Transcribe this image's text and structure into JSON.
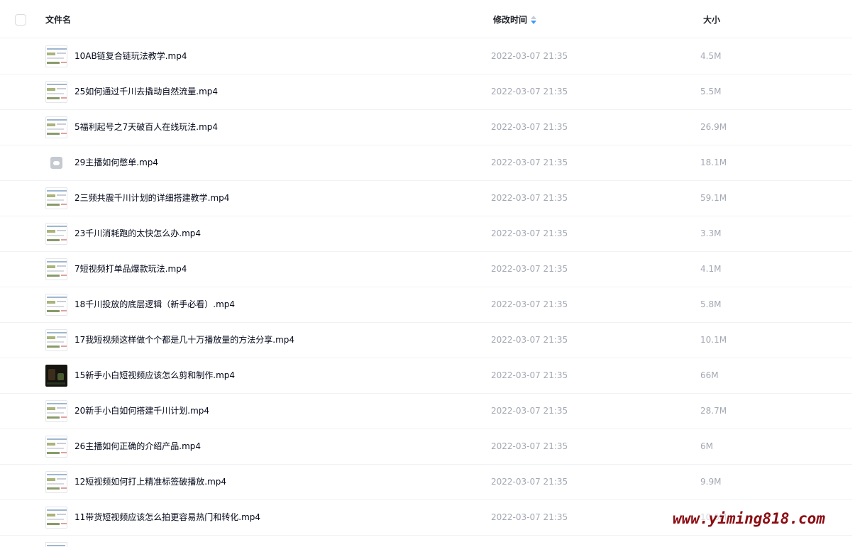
{
  "header": {
    "name_label": "文件名",
    "time_label": "修改时间",
    "size_label": "大小",
    "sort_icon": "sort-descending-icon"
  },
  "files": [
    {
      "name": "10AB链复合链玩法教学.mp4",
      "time": "2022-03-07 21:35",
      "size": "4.5M",
      "thumb": "screen"
    },
    {
      "name": "25如何通过千川去撬动自然流量.mp4",
      "time": "2022-03-07 21:35",
      "size": "5.5M",
      "thumb": "screen"
    },
    {
      "name": "5福利起号之7天破百人在线玩法.mp4",
      "time": "2022-03-07 21:35",
      "size": "26.9M",
      "thumb": "screen"
    },
    {
      "name": "29主播如何憋单.mp4",
      "time": "2022-03-07 21:35",
      "size": "18.1M",
      "thumb": "cloud"
    },
    {
      "name": "2三频共震千川计划的详细搭建教学.mp4",
      "time": "2022-03-07 21:35",
      "size": "59.1M",
      "thumb": "screen"
    },
    {
      "name": "23千川消耗跑的太快怎么办.mp4",
      "time": "2022-03-07 21:35",
      "size": "3.3M",
      "thumb": "screen"
    },
    {
      "name": "7短视频打单品爆款玩法.mp4",
      "time": "2022-03-07 21:35",
      "size": "4.1M",
      "thumb": "screen"
    },
    {
      "name": "18千川投放的底层逻辑（新手必看）.mp4",
      "time": "2022-03-07 21:35",
      "size": "5.8M",
      "thumb": "screen"
    },
    {
      "name": "17我短视频这样做个个都是几十万播放量的方法分享.mp4",
      "time": "2022-03-07 21:35",
      "size": "10.1M",
      "thumb": "screen"
    },
    {
      "name": "15新手小白短视频应该怎么剪和制作.mp4",
      "time": "2022-03-07 21:35",
      "size": "66M",
      "thumb": "dark"
    },
    {
      "name": "20新手小白如何搭建千川计划.mp4",
      "time": "2022-03-07 21:35",
      "size": "28.7M",
      "thumb": "screen"
    },
    {
      "name": "26主播如何正确的介绍产品.mp4",
      "time": "2022-03-07 21:35",
      "size": "6M",
      "thumb": "screen"
    },
    {
      "name": "12短视频如何打上精准标签破播放.mp4",
      "time": "2022-03-07 21:35",
      "size": "9.9M",
      "thumb": "screen"
    },
    {
      "name": "11带货短视频应该怎么拍更容易热门和转化.mp4",
      "time": "2022-03-07 21:35",
      "size": "10.6M",
      "thumb": "screen"
    }
  ],
  "watermark": "www.yiming818.com"
}
